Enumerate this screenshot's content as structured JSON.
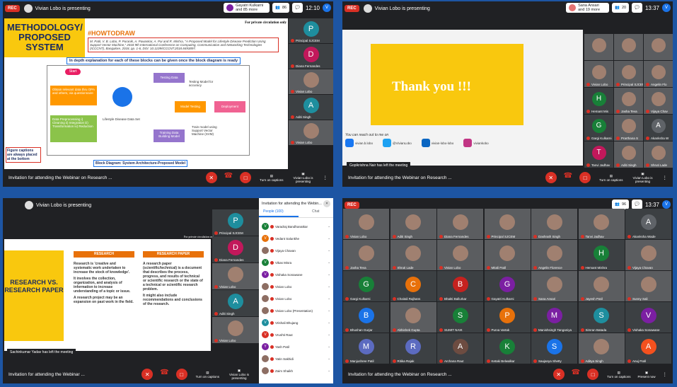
{
  "q1": {
    "rec": "REC",
    "presenting": "Vivian Lobo is presenting",
    "people_pill": "Gayatri Kulkarni and 85 more",
    "people_count": "86",
    "chat_badge": "1",
    "clock": "12:10",
    "account": "V",
    "meeting_title": "Invitation for attending the Webinar on Research ...",
    "captions": "Turn on captions",
    "presenter_tab": "Vivian Lobo is presenting",
    "slide": {
      "title": "METHODOLOGY/ PROPOSED SYSTEM",
      "private": "For private circulation only",
      "howto": "#HOWTODRAW",
      "citation": "M. Patil, V. B. Lobo, P. Puranik, A. Pawaskar, A. Pai and R. Mishra, \"A Proposed Model for Lifestyle Disease Prediction Using Support Vector Machine,\" 2018 9th International Conference on Computing, Communication and Networking Technologies (ICCCNT), Bangalore, 2018, pp. 1-6, DOI: 10.1109/ICCCNT.2018.8493897.",
      "indepth": "In depth explanation for each of these blocks can be given once the block diagram is ready",
      "start": "Start",
      "collect": "Obtain relevant data thru OPA and others, via questionnaire",
      "prep": "Data Preprocessing i) Cleaning ii) Integration iii) Transformation iv) Reduction",
      "dataset": "Lifestyle Disease Data Set",
      "testing": "Testing Data",
      "testing_model": "Testing Model for accuracy",
      "model_testing": "Model Testing",
      "deployment": "Deployment",
      "training": "Training Data Building Model",
      "train_svm": "Train model using Support Vector Machine (SVM)",
      "fig_note": "Figure captions are always placed at the bottom",
      "caption": "Block Diagram: System Architecture-Proposed Model"
    },
    "side": [
      {
        "name": "Principal SJCEM",
        "init": "P",
        "color": "#1e8e9e"
      },
      {
        "name": "Diana Fernandes",
        "init": "D",
        "color": "#c2185b"
      },
      {
        "name": "Vivian Lobo",
        "init": "",
        "color": ""
      },
      {
        "name": "Aditi Singh",
        "init": "A",
        "color": "#1e8e9e"
      },
      {
        "name": "Vivian Lobo",
        "init": "",
        "color": ""
      }
    ]
  },
  "q2": {
    "rec": "REC",
    "presenting": "Vivian Lobo is presenting",
    "people_pill": "Sana Ansari and 19 more",
    "people_count": "20",
    "chat_badge": "1",
    "clock": "13:37",
    "account": "V",
    "meeting_title": "Invitation for attending the Webinar on Research ...",
    "captions": "Turn on captions",
    "presenter_tab": "Vivian Lobo is presenting",
    "thank": "Thank you !!!",
    "reach": "You can reach out to me on",
    "socials": [
      {
        "n": "facebook",
        "label": "vivian.b.lobo",
        "c": "#1877f2"
      },
      {
        "n": "twitter",
        "label": "@VivianLobo",
        "c": "#1da1f2"
      },
      {
        "n": "linkedin",
        "label": "vivian-lobo-lobo",
        "c": "#0a66c2"
      },
      {
        "n": "instagram",
        "label": "viviankobo",
        "c": "#c13584"
      }
    ],
    "toast": "Gopikrishna Nair has left the meeting",
    "grid": [
      {
        "n": "",
        "i": "",
        "c": ""
      },
      {
        "n": "",
        "i": "",
        "c": ""
      },
      {
        "n": "",
        "i": "",
        "c": ""
      },
      {
        "n": "Vivian Lobo",
        "i": "",
        "c": ""
      },
      {
        "n": "Principal SJCEM",
        "i": "",
        "c": ""
      },
      {
        "n": "Angelin Flo",
        "i": "",
        "c": ""
      },
      {
        "n": "Hemant Mis",
        "i": "H",
        "c": "#188038"
      },
      {
        "n": "Jasha Teva",
        "i": "",
        "c": ""
      },
      {
        "n": "Vijaya Chav",
        "i": "",
        "c": ""
      },
      {
        "n": "Gargi Kulkarni",
        "i": "G",
        "c": "#188038"
      },
      {
        "n": "Prarthana S",
        "i": "",
        "c": ""
      },
      {
        "n": "Akanksha W",
        "i": "A",
        "c": "#5f6368"
      },
      {
        "n": "Tanvi Jadhav",
        "i": "T",
        "c": "#c2185b"
      },
      {
        "n": "Aditi Singh",
        "i": "",
        "c": ""
      },
      {
        "n": "Shruti Lade",
        "i": "",
        "c": ""
      }
    ]
  },
  "q3": {
    "presenting": "Vivian Lobo is presenting",
    "meeting_title": "Invitation for attending the Webinar ...",
    "captions": "Turn on captions",
    "presenter_tab": "Vivian Lobo is presenting",
    "private": "For private circulation only",
    "toast": "Sachinkumar Yadav has left the meeting",
    "slide": {
      "left_title": "RESEARCH VS. RESEARCH PAPER",
      "h1": "RESEARCH",
      "h2": "RESEARCH PAPER",
      "r1": "Research is 'creative and systematic work undertaken to increase the stock of knowledge'.",
      "r2": "It involves the collection, organization, and analysis of information to increase understanding of a topic or issue.",
      "r3": "A research project may be an expansion on past work in the field.",
      "p1": "A research paper (scientific/technical) is a document that describes the process, progress, and results of technical or scientific research or the state of a technical or scientific research problem.",
      "p2": "It might also include recommendations and conclusions of the research."
    },
    "side": [
      {
        "name": "Principal SJCEM",
        "init": "P",
        "color": "#1e8e9e"
      },
      {
        "name": "Diana Fernandes",
        "init": "D",
        "color": "#c2185b"
      },
      {
        "name": "Vivian Lobo",
        "init": "",
        "color": ""
      },
      {
        "name": "Aditi Singh",
        "init": "A",
        "color": "#1e8e9e"
      },
      {
        "name": "Vivian Lobo",
        "init": "",
        "color": ""
      }
    ],
    "panel": {
      "title": "Invitation for attending the Webin...",
      "tab_people": "People (100)",
      "tab_chat": "Chat",
      "people": [
        {
          "n": "Varadraj Bandhanatkar",
          "i": "V",
          "c": "#188038"
        },
        {
          "n": "Vedant Salunkhe",
          "i": "V",
          "c": "#e8710a"
        },
        {
          "n": "Vijaya Chavan",
          "i": "",
          "c": ""
        },
        {
          "n": "Vikas Misra",
          "i": "V",
          "c": "#188038"
        },
        {
          "n": "Vishaka Sonawane",
          "i": "V",
          "c": "#7b1fa2"
        },
        {
          "n": "Vivian Lobo",
          "i": "",
          "c": ""
        },
        {
          "n": "Vivian Lobo",
          "i": "",
          "c": ""
        },
        {
          "n": "Vivian Lobo (Presentation)",
          "i": "",
          "c": ""
        },
        {
          "n": "Vrishali Bhujang",
          "i": "V",
          "c": "#1e8e9e"
        },
        {
          "n": "Vrushti Raut",
          "i": "V",
          "c": "#d93025"
        },
        {
          "n": "Yash Patil",
          "i": "Y",
          "c": "#7b1fa2"
        },
        {
          "n": "Yatin Sakhidi",
          "i": "",
          "c": ""
        },
        {
          "n": "Zaim Shaikh",
          "i": "",
          "c": ""
        }
      ]
    }
  },
  "q4": {
    "rec": "REC",
    "people_count": "96",
    "chat_badge": "1",
    "clock": "13:37",
    "account": "V",
    "meeting_title": "Invitation for attending the Webinar on Research ...",
    "captions": "Turn on captions",
    "present_now": "Present now",
    "grid": [
      {
        "n": "Vivian Lobo",
        "i": "",
        "c": ""
      },
      {
        "n": "Aditi Singh",
        "i": "",
        "c": ""
      },
      {
        "n": "Diana Fernandes",
        "i": "",
        "c": ""
      },
      {
        "n": "Principal SJCEM",
        "i": "",
        "c": ""
      },
      {
        "n": "Dashrath Singh",
        "i": "",
        "c": ""
      },
      {
        "n": "Tanvi Jadhav",
        "i": "",
        "c": ""
      },
      {
        "n": "Akanksha Wade",
        "i": "A",
        "c": "#5f6368"
      },
      {
        "n": "Jasha Teva",
        "i": "",
        "c": ""
      },
      {
        "n": "Shruti Lade",
        "i": "",
        "c": ""
      },
      {
        "n": "Vivian Lobo",
        "i": "",
        "c": ""
      },
      {
        "n": "Mitali Patil",
        "i": "",
        "c": ""
      },
      {
        "n": "Angelin Florence",
        "i": "",
        "c": ""
      },
      {
        "n": "Hemant Mishra",
        "i": "H",
        "c": "#188038"
      },
      {
        "n": "Vijaya Chavan",
        "i": "",
        "c": ""
      },
      {
        "n": "Gargi Kulkarni",
        "i": "G",
        "c": "#188038"
      },
      {
        "n": "Chaitali Rajhans",
        "i": "C",
        "c": "#e8710a"
      },
      {
        "n": "Bhakti Ballurkar",
        "i": "B",
        "c": "#c5221f"
      },
      {
        "n": "Gayatri Kulkarni",
        "i": "G",
        "c": "#7b1fa2"
      },
      {
        "n": "Sana Ansari",
        "i": "",
        "c": ""
      },
      {
        "n": "Jayesh Patil",
        "i": "",
        "c": ""
      },
      {
        "n": "Sunny Sali",
        "i": "",
        "c": ""
      },
      {
        "n": "Bhushan Gurjar",
        "i": "B",
        "c": "#1a73e8"
      },
      {
        "n": "Abhishek Gupta",
        "i": "",
        "c": ""
      },
      {
        "n": "SUMIT NAIK",
        "i": "S",
        "c": "#188038"
      },
      {
        "n": "Purva Vartak",
        "i": "P",
        "c": "#e8710a"
      },
      {
        "n": "Manishsingh Tanganiya",
        "i": "M",
        "c": "#7b1fa2"
      },
      {
        "n": "Simran Batada",
        "i": "S",
        "c": "#1e8e9e"
      },
      {
        "n": "Vishaka Sonawane",
        "i": "V",
        "c": "#7b1fa2"
      },
      {
        "n": "Manjushree Patil",
        "i": "M",
        "c": "#5c6bc0"
      },
      {
        "n": "Ritika Rajak",
        "i": "R",
        "c": "#5c6bc0"
      },
      {
        "n": "Archana Raut",
        "i": "A",
        "c": "#6d4c41"
      },
      {
        "n": "Ketaki Belwalkar",
        "i": "K",
        "c": "#188038"
      },
      {
        "n": "Saujanya Shetty",
        "i": "S",
        "c": "#1a73e8"
      },
      {
        "n": "Aditya Singh",
        "i": "",
        "c": ""
      },
      {
        "n": "Anuj Patil",
        "i": "A",
        "c": "#f4511e"
      }
    ]
  }
}
